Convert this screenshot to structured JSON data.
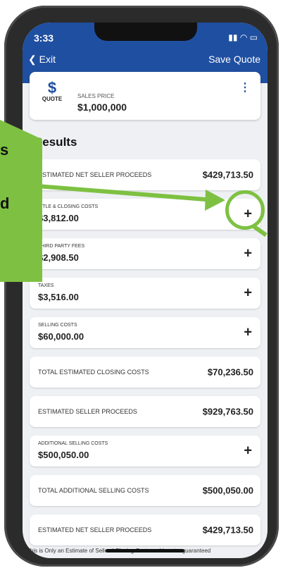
{
  "status": {
    "time": "3:33"
  },
  "header": {
    "exit": "Exit",
    "save": "Save Quote"
  },
  "quote": {
    "icon_label": "QUOTE",
    "sales_price_label": "SALES PRICE",
    "sales_price": "$1,000,000"
  },
  "results_title": "Results",
  "rows": [
    {
      "label": "ESTIMATED NET SELLER PROCEEDS",
      "value": "$429,713.50"
    },
    {
      "label": "TITLE & CLOSING COSTS",
      "value": "$3,812.00"
    },
    {
      "label": "THIRD PARTY FEES",
      "value": "$2,908.50"
    },
    {
      "label": "TAXES",
      "value": "$3,516.00"
    },
    {
      "label": "SELLING COSTS",
      "value": "$60,000.00"
    },
    {
      "label": "TOTAL ESTIMATED CLOSING COSTS",
      "value": "$70,236.50"
    },
    {
      "label": "ESTIMATED SELLER PROCEEDS",
      "value": "$929,763.50"
    },
    {
      "label": "ADDITIONAL SELLING COSTS",
      "value": "$500,050.00"
    },
    {
      "label": "TOTAL ADDITIONAL SELLING COSTS",
      "value": "$500,050.00"
    },
    {
      "label": "ESTIMATED NET SELLER PROCEEDS",
      "value": "$429,713.50"
    }
  ],
  "footer": "This is Only an Estimate of Sellers' Closing Costs and is not a guaranteed",
  "overlay": {
    "top_text": "s",
    "mid_text": "d"
  },
  "colors": {
    "header_blue": "#1f4fa0",
    "accent_green": "#7ec142"
  }
}
